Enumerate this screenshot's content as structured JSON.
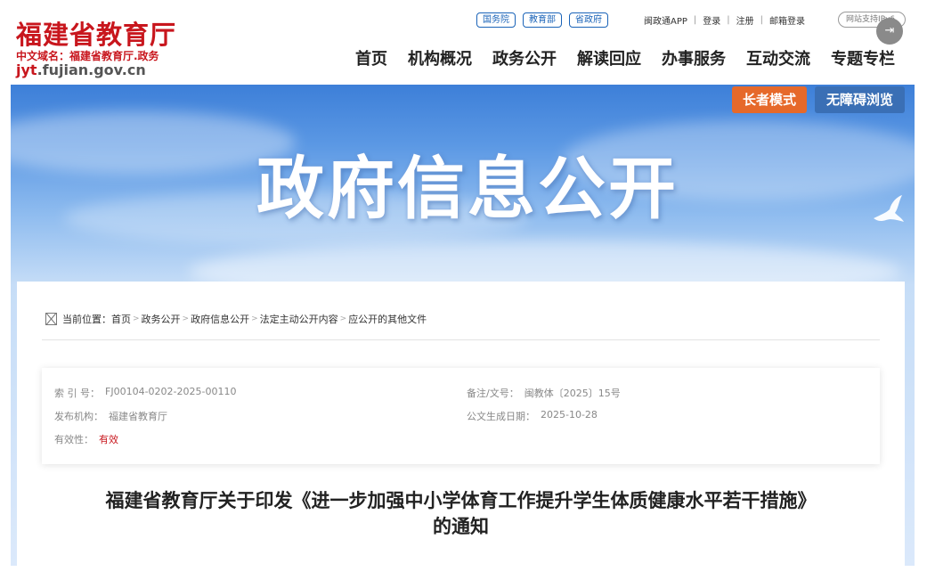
{
  "header": {
    "site_title": "福建省教育厅",
    "domain_cn": "中文域名：福建省教育厅.政务",
    "domain_url_prefix": "jyt",
    "domain_url_suffix": ".fujian.gov.cn",
    "top_pills": [
      "国务院",
      "教育部",
      "省政府"
    ],
    "top_links": [
      "闽政通APP",
      "登录",
      "注册",
      "邮箱登录"
    ],
    "support_label": "网站支持IPv6",
    "nav": [
      "首页",
      "机构概况",
      "政务公开",
      "解读回应",
      "办事服务",
      "互动交流",
      "专题专栏"
    ]
  },
  "banner": {
    "title": "政府信息公开",
    "elder_mode": "长者模式",
    "accessible": "无障碍浏览"
  },
  "breadcrumb": {
    "label": "当前位置：",
    "items": [
      "首页",
      "政务公开",
      "政府信息公开",
      "法定主动公开内容",
      "应公开的其他文件"
    ]
  },
  "meta": {
    "index_label": "索 引 号：",
    "index_value": "FJ00104-0202-2025-00110",
    "docno_label": "备注/文号：",
    "docno_value": "闽教体〔2025〕15号",
    "publisher_label": "发布机构：",
    "publisher_value": "福建省教育厅",
    "date_label": "公文生成日期：",
    "date_value": "2025-10-28",
    "validity_label": "有效性：",
    "validity_value": "有效"
  },
  "document": {
    "title_line1": "福建省教育厅关于印发《进一步加强中小学体育工作提升学生体质健康水平若干措施》",
    "title_line2": "的通知"
  }
}
